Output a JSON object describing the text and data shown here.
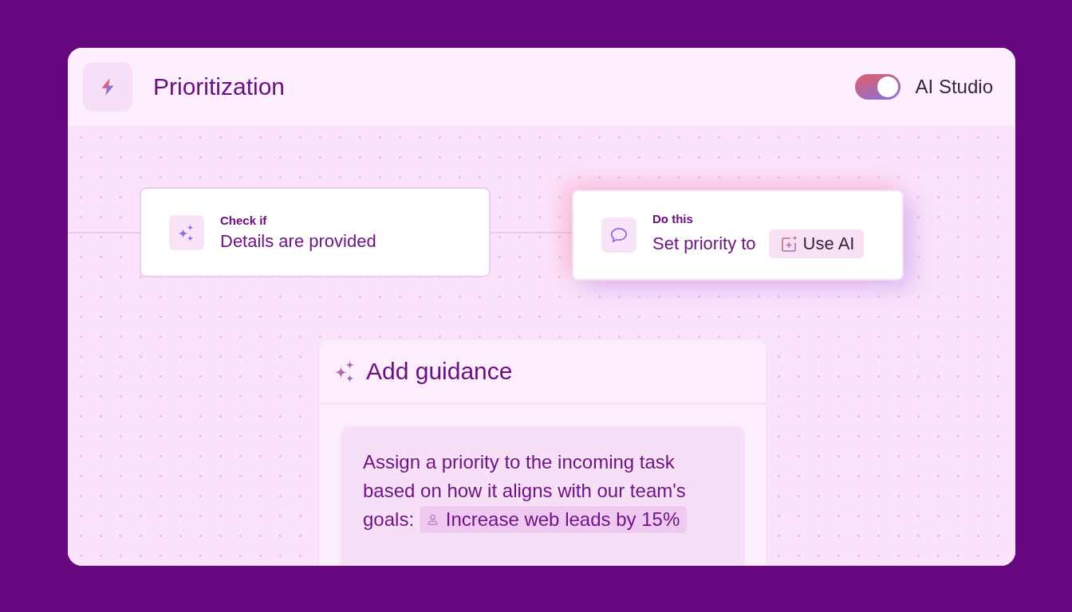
{
  "header": {
    "title": "Prioritization",
    "toggle": {
      "label": "AI Studio",
      "on": true
    }
  },
  "flow": {
    "nodes": [
      {
        "kind": "condition",
        "selected": false,
        "caption": "Check if",
        "text": "Details are provided"
      },
      {
        "kind": "action",
        "selected": true,
        "caption": "Do this",
        "text": "Set priority to",
        "button": "Use AI"
      }
    ]
  },
  "guidance": {
    "title": "Add guidance",
    "text": "Assign a priority to the incoming task based on how it aligns with our team's goals:",
    "goal_chip": "Increase web leads by 15%"
  }
}
